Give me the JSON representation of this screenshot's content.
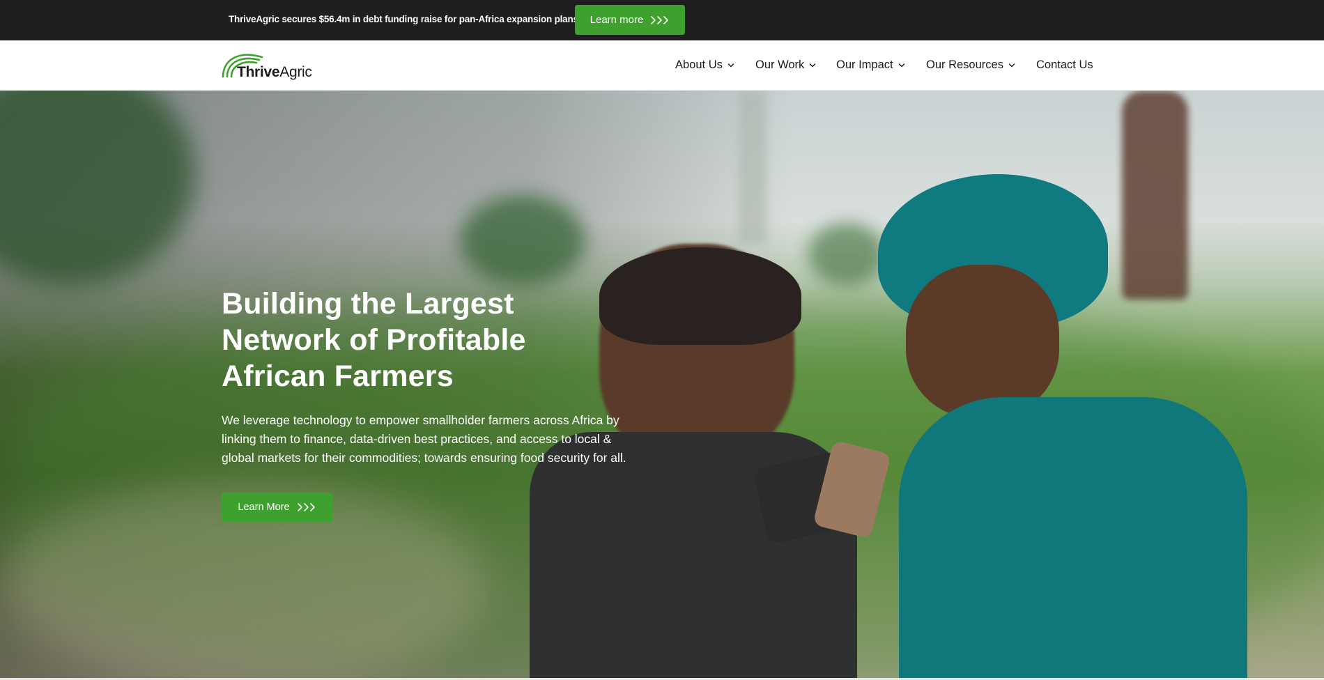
{
  "colors": {
    "brand_green": "#3fa12d",
    "announce_bg": "#1f1f1f",
    "nav_text": "#1b1b1b"
  },
  "announcement": {
    "text": "ThriveAgric secures $56.4m in debt funding raise for pan-Africa expansion plans",
    "button_label": "Learn more",
    "button_icon": "triple-chevron-right-icon"
  },
  "logo": {
    "bold_part": "Thrive",
    "light_part": "Agric",
    "icon": "arc-logo-icon"
  },
  "nav": {
    "items": [
      {
        "label": "About Us",
        "has_dropdown": true
      },
      {
        "label": "Our Work",
        "has_dropdown": true
      },
      {
        "label": "Our Impact",
        "has_dropdown": true
      },
      {
        "label": "Our Resources",
        "has_dropdown": true
      },
      {
        "label": "Contact Us",
        "has_dropdown": false
      }
    ]
  },
  "hero": {
    "title": "Building the Largest Network of Profitable African Farmers",
    "description": "We leverage technology to empower smallholder farmers across Africa by linking them to finance, data-driven best practices, and access to local & global markets for their commodities; towards ensuring food security for all.",
    "button_label": "Learn More",
    "button_icon": "triple-chevron-right-icon"
  }
}
